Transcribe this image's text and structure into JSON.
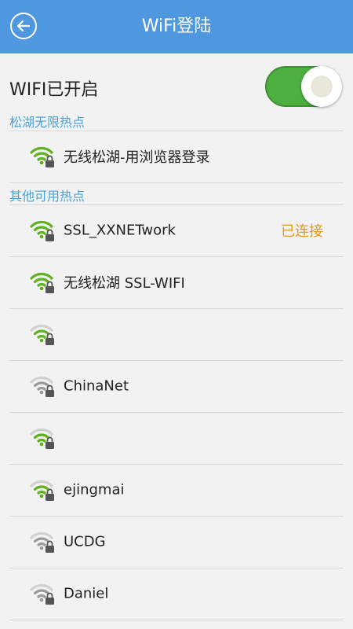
{
  "header": {
    "title": "WiFi登陆"
  },
  "wifi_toggle": {
    "label": "WIFI已开启",
    "on": true
  },
  "colors": {
    "header": "#4f98e0",
    "accent": "#4aa3d8",
    "toggle_on": "#4caf3f",
    "signal_green": "#5fb21f",
    "signal_gray": "#9a9a9a",
    "connected": "#e39a16"
  },
  "sections": [
    {
      "title": "松湖无限热点",
      "networks": [
        {
          "name": "无线松湖-用浏览器登录",
          "signal": "green",
          "locked": true,
          "status": ""
        }
      ]
    },
    {
      "title": "其他可用热点",
      "networks": [
        {
          "name": "SSL_XXNETwork",
          "signal": "green",
          "locked": true,
          "status": "已连接"
        },
        {
          "name": "无线松湖 SSL-WIFI",
          "signal": "green",
          "locked": true,
          "status": ""
        },
        {
          "name": "",
          "signal": "green-weak",
          "locked": true,
          "status": ""
        },
        {
          "name": "ChinaNet",
          "signal": "gray",
          "locked": true,
          "status": ""
        },
        {
          "name": "",
          "signal": "green-weak",
          "locked": true,
          "status": ""
        },
        {
          "name": "ejingmai",
          "signal": "green-weak",
          "locked": true,
          "status": ""
        },
        {
          "name": "UCDG",
          "signal": "gray",
          "locked": true,
          "status": ""
        },
        {
          "name": "Daniel",
          "signal": "gray",
          "locked": true,
          "status": ""
        }
      ]
    }
  ]
}
